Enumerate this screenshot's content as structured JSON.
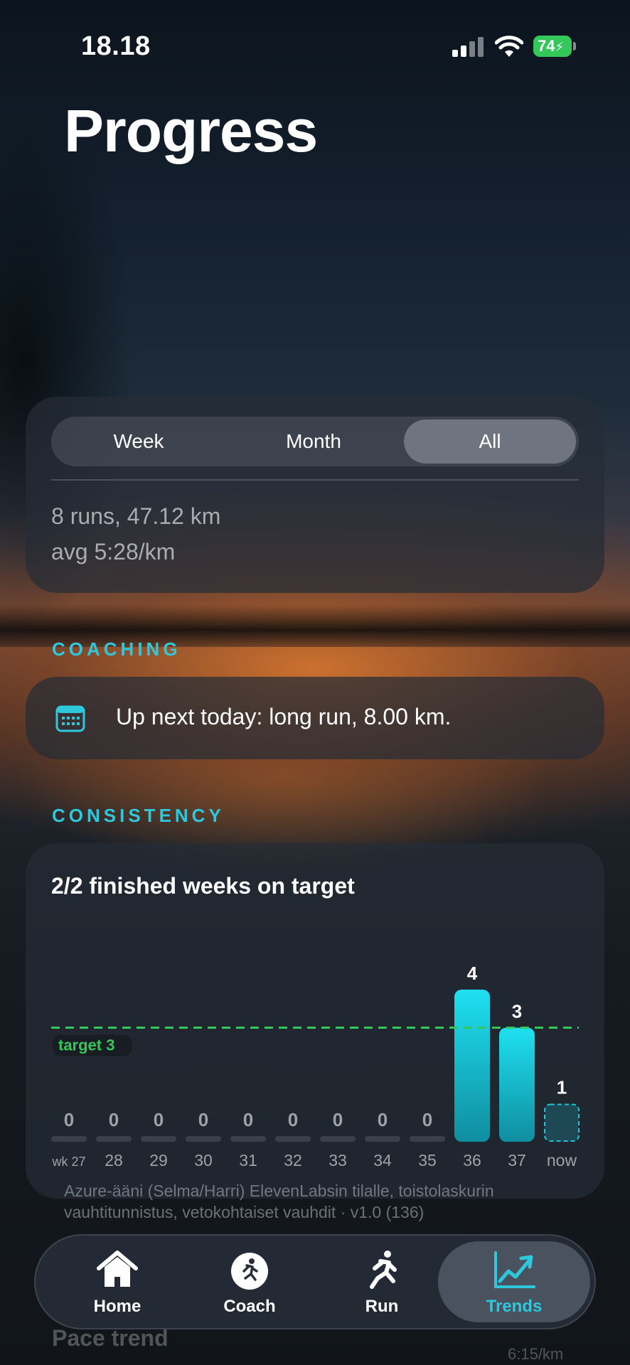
{
  "status_bar": {
    "time": "18.18",
    "battery": "74"
  },
  "page": {
    "title": "Progress"
  },
  "summary": {
    "segments": [
      "Week",
      "Month",
      "All"
    ],
    "selected_segment": "All",
    "line1": "8 runs, 47.12 km",
    "line2": "avg 5:28/km"
  },
  "coaching": {
    "section_label": "COACHING",
    "text": "Up next today: long run, 8.00 km.",
    "icon": "calendar-icon"
  },
  "consistency": {
    "section_label": "CONSISTENCY",
    "title": "2/2 finished weeks on target"
  },
  "chart_data": {
    "type": "bar",
    "categories": [
      "wk 27",
      "28",
      "29",
      "30",
      "31",
      "32",
      "33",
      "34",
      "35",
      "36",
      "37",
      "now"
    ],
    "values": [
      0,
      0,
      0,
      0,
      0,
      0,
      0,
      0,
      0,
      4,
      3,
      1
    ],
    "target": 3,
    "target_label": "target 3",
    "ylim": [
      0,
      4
    ],
    "colors": {
      "bar": "#16c6da",
      "target_line": "#35c759",
      "empty_bar": "#3a404a"
    }
  },
  "footer": {
    "note": "Azure-ääni (Selma/Harri) ElevenLabsin tilalle, toistolaskurin vauhtitunnistus, vetokohtaiset vauhdit · v1.0 (136)",
    "behind_label": "Pace trend",
    "behind_pace": "6:15/km"
  },
  "tabbar": {
    "items": [
      {
        "label": "Home",
        "icon": "house-icon"
      },
      {
        "label": "Coach",
        "icon": "coach-icon"
      },
      {
        "label": "Run",
        "icon": "runner-icon"
      },
      {
        "label": "Trends",
        "icon": "chart-trend-icon"
      }
    ],
    "selected": "Trends"
  },
  "colors": {
    "accent": "#2ec8dc",
    "battery": "#34c759"
  }
}
